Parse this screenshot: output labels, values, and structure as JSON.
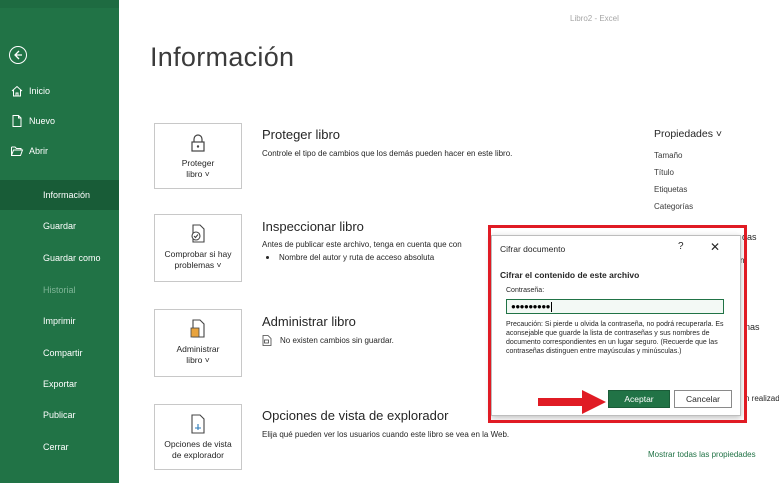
{
  "window": {
    "title": "Libro2 - Excel"
  },
  "sidebar": {
    "back_icon": "back-arrow-icon",
    "items": [
      {
        "label": "Inicio",
        "icon": "home-icon"
      },
      {
        "label": "Nuevo",
        "icon": "new-document-icon"
      },
      {
        "label": "Abrir",
        "icon": "open-folder-icon"
      },
      {
        "label": "Información"
      },
      {
        "label": "Guardar"
      },
      {
        "label": "Guardar como"
      },
      {
        "label": "Historial"
      },
      {
        "label": "Imprimir"
      },
      {
        "label": "Compartir"
      },
      {
        "label": "Exportar"
      },
      {
        "label": "Publicar"
      },
      {
        "label": "Cerrar"
      }
    ],
    "active": "Información",
    "colors": {
      "background": "#217346",
      "active": "#185c37"
    }
  },
  "page": {
    "title": "Información"
  },
  "sections": [
    {
      "button_label_1": "Proteger",
      "button_label_2": "libro ˅",
      "icon": "lock-icon",
      "title": "Proteger libro",
      "description": "Controle el tipo de cambios que los demás pueden hacer en este libro."
    },
    {
      "button_label_1": "Comprobar si hay",
      "button_label_2": "problemas ˅",
      "icon": "inspect-document-icon",
      "title": "Inspeccionar libro",
      "description": "Antes de publicar este archivo, tenga en cuenta que con",
      "bullet": "Nombre del autor y ruta de acceso absoluta"
    },
    {
      "button_label_1": "Administrar",
      "button_label_2": "libro ˅",
      "icon": "manage-workbook-icon",
      "title": "Administrar libro",
      "note": "No existen cambios sin guardar."
    },
    {
      "button_label_1": "Opciones de vista",
      "button_label_2": "de explorador",
      "icon": "browser-view-icon",
      "title": "Opciones de vista de explorador",
      "description": "Elija qué pueden ver los usuarios cuando este libro se vea en la Web."
    }
  ],
  "properties": {
    "heading": "Propiedades ˅",
    "items": [
      "Tamaño",
      "Título",
      "Etiquetas",
      "Categorías"
    ],
    "partial_1": "das",
    "partial_2": "n",
    "partial_3": "nas",
    "partial_4": "n realizada",
    "link": "Mostrar todas las propiedades"
  },
  "dialog": {
    "title": "Cifrar documento",
    "help": "?",
    "close": "✕",
    "heading": "Cifrar el contenido de este archivo",
    "password_label": "Contraseña:",
    "password_value": "●●●●●●●●●",
    "warning": "Precaución: Si pierde u olvida la contraseña, no podrá recuperarla. Es aconsejable que guarde la lista de contraseñas y sus nombres de documento correspondientes en un lugar seguro. (Recuerde que las contraseñas distinguen entre mayúsculas y minúsculas.)",
    "ok_label": "Aceptar",
    "cancel_label": "Cancelar"
  },
  "annotation": {
    "highlight_color": "#e01b24"
  }
}
